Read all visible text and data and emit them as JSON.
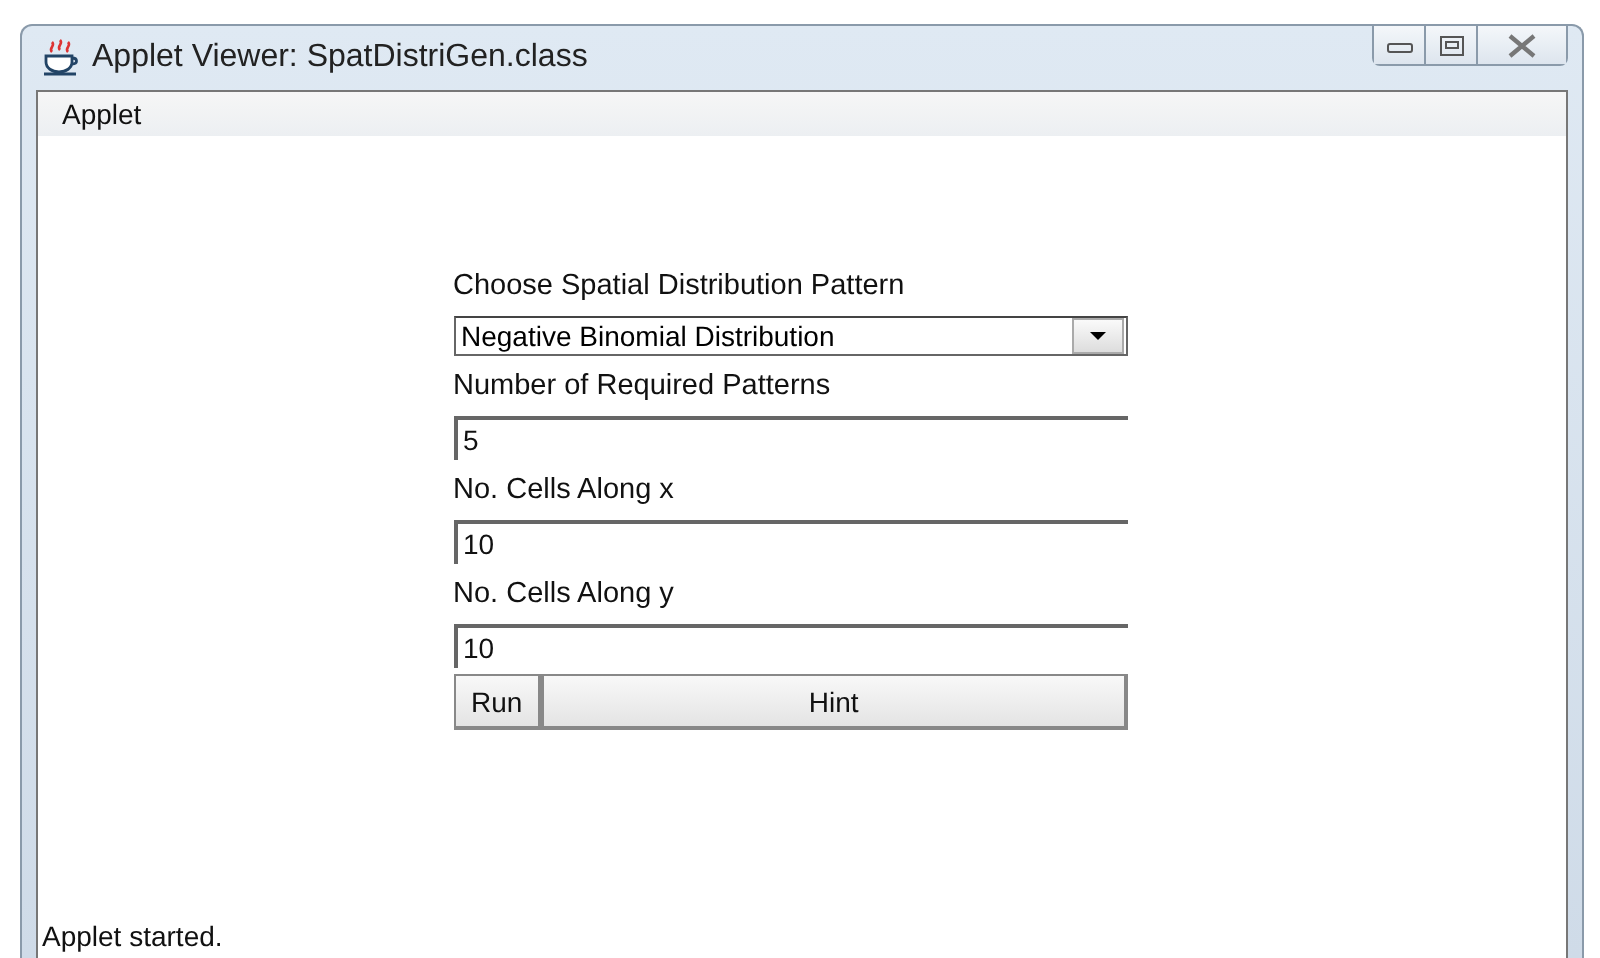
{
  "window": {
    "title": "Applet Viewer: SpatDistriGen.class"
  },
  "menu": [
    "Applet"
  ],
  "form": {
    "items": [
      {
        "kind": "label",
        "text": "Choose Spatial Distribution Pattern"
      },
      {
        "kind": "dropdown",
        "value": "Negative Binomial Distribution"
      },
      {
        "kind": "label",
        "text": "Number of Required Patterns"
      },
      {
        "kind": "field",
        "value": "5"
      },
      {
        "kind": "label",
        "text": "No. Cells Along x"
      },
      {
        "kind": "field",
        "value": "10"
      },
      {
        "kind": "label",
        "text": "No. Cells Along y"
      },
      {
        "kind": "field",
        "value": "10"
      }
    ],
    "buttons": [
      "Run",
      "Hint"
    ]
  },
  "status_bar": "Applet started."
}
